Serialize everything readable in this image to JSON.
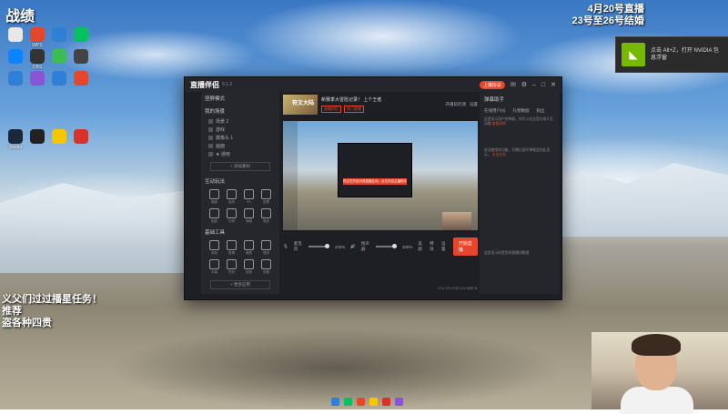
{
  "overlays": {
    "title": "战绩",
    "top_right_line1": "4月20号直播",
    "top_right_line2": "23号至26号结婚",
    "left_line1": "义父们过过播星任务！",
    "left_line2": "推荐",
    "left_line3": "盗各种四贵"
  },
  "nvidia_toast": {
    "text_line1": "点击 Alt+Z，打开 NVIDIA 包",
    "text_line2": "息浮窗",
    "logo": "nvidia-icon"
  },
  "desktop_icons": [
    {
      "label": "",
      "color": "#e8e8e8"
    },
    {
      "label": "WPS",
      "color": "#e5472c"
    },
    {
      "label": "",
      "color": "#2f7fd6"
    },
    {
      "label": "",
      "color": "#07c160"
    },
    {
      "label": "",
      "color": "#0a84ff"
    },
    {
      "label": "OBS",
      "color": "#333333"
    },
    {
      "label": "",
      "color": "#3dbb55"
    },
    {
      "label": "",
      "color": "#444444"
    },
    {
      "label": "",
      "color": "#2f7fd6"
    },
    {
      "label": "",
      "color": "#8a55d4"
    },
    {
      "label": "",
      "color": "#2f7fd6"
    },
    {
      "label": "",
      "color": "#e5472c"
    },
    {
      "label": "Steam",
      "color": "#1b2838"
    },
    {
      "label": "",
      "color": "#222222"
    },
    {
      "label": "",
      "color": "#f7c600"
    },
    {
      "label": "",
      "color": "#d8322b"
    }
  ],
  "app": {
    "logo": "直播伴侣",
    "version": "9.1.2",
    "live_pill": "上播协议",
    "left_panel": {
      "section1": "竖屏模式",
      "my_scenes": "我的场景",
      "scenes": [
        "场景 2",
        "游戏",
        "摄像头 1",
        "画面",
        "★ 通用"
      ],
      "add_scene": "+ 添加素材",
      "section2": "互动玩法",
      "section3": "基础工具",
      "interactions": [
        "福袋",
        "连线",
        "PK",
        "投票",
        "抽奖",
        "礼物",
        "弹幕",
        "更多"
      ],
      "tools": [
        "录制",
        "剪辑",
        "美颜",
        "音效",
        "字幕",
        "任务",
        "贴纸",
        "设置"
      ],
      "more_tools": "+ 更多应用"
    },
    "header": {
      "thumb_text": "符文大陆",
      "title": "新赛季大冒险记录！ 上个王者",
      "tags": [
        "直播伴侣",
        "热门直播"
      ],
      "right_items": [
        "开播前检测",
        "设置"
      ]
    },
    "preview": {
      "alert_text": "你正在开启抖音直播互动，点击开启主播助手"
    },
    "bottom": {
      "mic_label": "麦克风",
      "mic_value": "100%",
      "speaker_label": "扬声器",
      "speaker_value": "100%",
      "buttons": [
        "美颜",
        "特效",
        "设置"
      ],
      "go_live": "开始直播"
    },
    "stats": "CPU 23%  内存 42%  帧率 60",
    "right_panel": {
      "title": "弹幕助手",
      "tabs": [
        "在线用户(0)",
        "礼物数据",
        "粉丝"
      ],
      "text1": "这里显示用户的弹幕，你可以在这里与观众互动哦",
      "link1": "查看说明",
      "text2": "欢迎使用本功能，开播后观众弹幕会在此显示。",
      "link2": "点击开启",
      "footer": "这里显示的是您的直播间数据"
    }
  },
  "taskbar": [
    "windows-icon",
    "wechat-icon",
    "browser-icon",
    "folder-icon",
    "record-icon",
    "app-icon"
  ]
}
